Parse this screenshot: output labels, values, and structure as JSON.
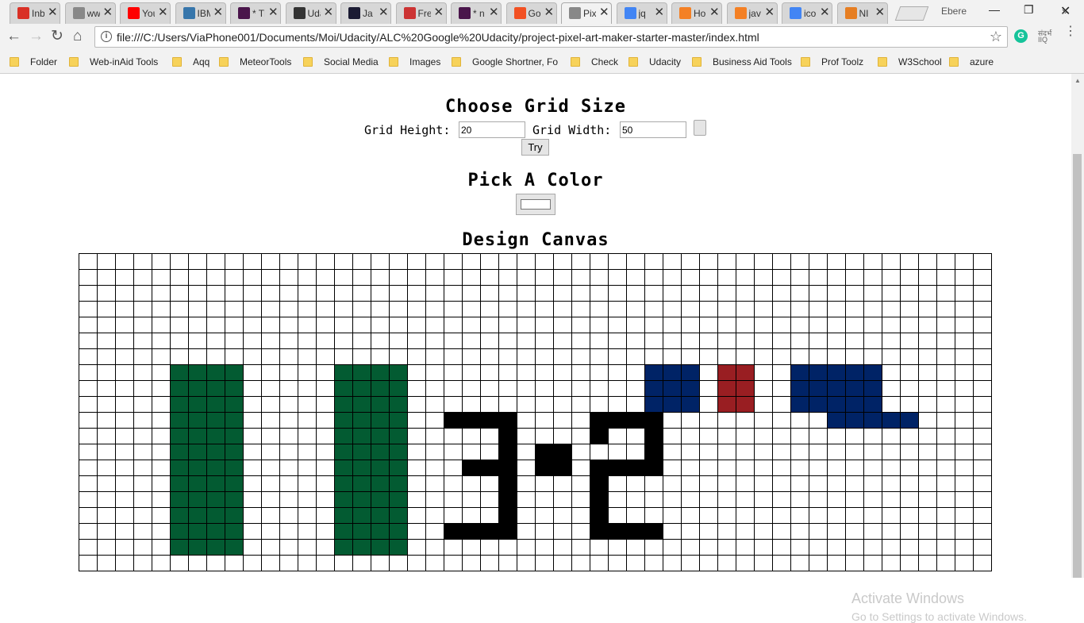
{
  "browser": {
    "tabs": [
      {
        "title": "Inbox",
        "favicon": "gmail-icon",
        "color": "#d93025"
      },
      {
        "title": "www",
        "favicon": "page-icon",
        "color": "#888888"
      },
      {
        "title": "YouTube",
        "favicon": "youtube-icon",
        "color": "#ff0000"
      },
      {
        "title": "IBM",
        "favicon": "python-icon",
        "color": "#3776ab"
      },
      {
        "title": "* Th",
        "favicon": "slack-icon",
        "color": "#4a154b"
      },
      {
        "title": "Udacity",
        "favicon": "codepen-icon",
        "color": "#333333"
      },
      {
        "title": "Ja",
        "favicon": "30-icon",
        "color": "#1b1b33"
      },
      {
        "title": "Fre",
        "favicon": "freecodecamp-icon",
        "color": "#cc3333"
      },
      {
        "title": "* n",
        "favicon": "slack-icon",
        "color": "#4a154b"
      },
      {
        "title": "Go",
        "favicon": "microsoft-icon",
        "color": "#f25022"
      },
      {
        "title": "Pix",
        "favicon": "page-icon",
        "color": "#888888",
        "active": true
      },
      {
        "title": "jq",
        "favicon": "google-icon",
        "color": "#4285f4"
      },
      {
        "title": "Ho",
        "favicon": "stackoverflow-icon",
        "color": "#f48024"
      },
      {
        "title": "jav",
        "favicon": "stackoverflow-icon",
        "color": "#f48024"
      },
      {
        "title": "ico",
        "favicon": "google-icon",
        "color": "#4285f4"
      },
      {
        "title": "NI",
        "favicon": "eye-icon",
        "color": "#e67e22"
      }
    ],
    "profile": "Ebere",
    "url": "file:///C:/Users/ViaPhone001/Documents/Moi/Udacity/ALC%20Google%20Udacity/project-pixel-art-maker-starter-master/index.html",
    "grammarly_label": "G",
    "ext_label_top": "संदर्भ",
    "ext_label_bottom": "IIQ",
    "bookmarks": [
      "Folder",
      "Web-inAid Tools",
      "Aqq",
      "MeteorTools",
      "Social Media",
      "Images",
      "Google Shortner, Fo",
      "Check",
      "Udacity",
      "Business Aid Tools",
      "Prof Toolz",
      "W3School",
      "azure"
    ]
  },
  "page": {
    "grid_title": "Choose Grid Size",
    "height_label": "Grid Height:",
    "height_value": "20",
    "width_label": "Grid Width:",
    "width_value": "50",
    "try_label": "Try",
    "color_title": "Pick A Color",
    "selected_color": "#ffffff",
    "canvas_title": "Design Canvas"
  },
  "canvas": {
    "rows": 20,
    "cols": 50,
    "palette": {
      "G": "#035b32",
      "K": "#000000",
      "B": "#002366",
      "R": "#991e22"
    },
    "pixels": [
      "..................................................",
      "..................................................",
      "..................................................",
      "..................................................",
      "..................................................",
      "..................................................",
      "..................................................",
      ".....GGGG.....GGGG.............BBB.RR..BBBBB......",
      ".....GGGG.....GGGG.............BBB.RR..BBBBB......",
      ".....GGGG.....GGGG.............BBB.RR..BBBBB......",
      ".....GGGG.....GGGG..KKKK....KKKK.........BBBBB......",
      ".....GGGG.....GGGG.....K....K..K..................",
      ".....GGGG.....GGGG.....K.KK....K..................",
      ".....GGGG.....GGGG...KKK.KK.KKKK..................",
      ".....GGGG.....GGGG.....K....K.....................",
      ".....GGGG.....GGGG.....K....K.....................",
      ".....GGGG.....GGGG.....K....K.....................",
      ".....GGGG.....GGGG..KKKK....KKKK..................",
      ".....GGGG.....GGGG................................",
      ".................................................."
    ]
  },
  "watermark": {
    "line1": "Activate Windows",
    "line2": "Go to Settings to activate Windows."
  }
}
